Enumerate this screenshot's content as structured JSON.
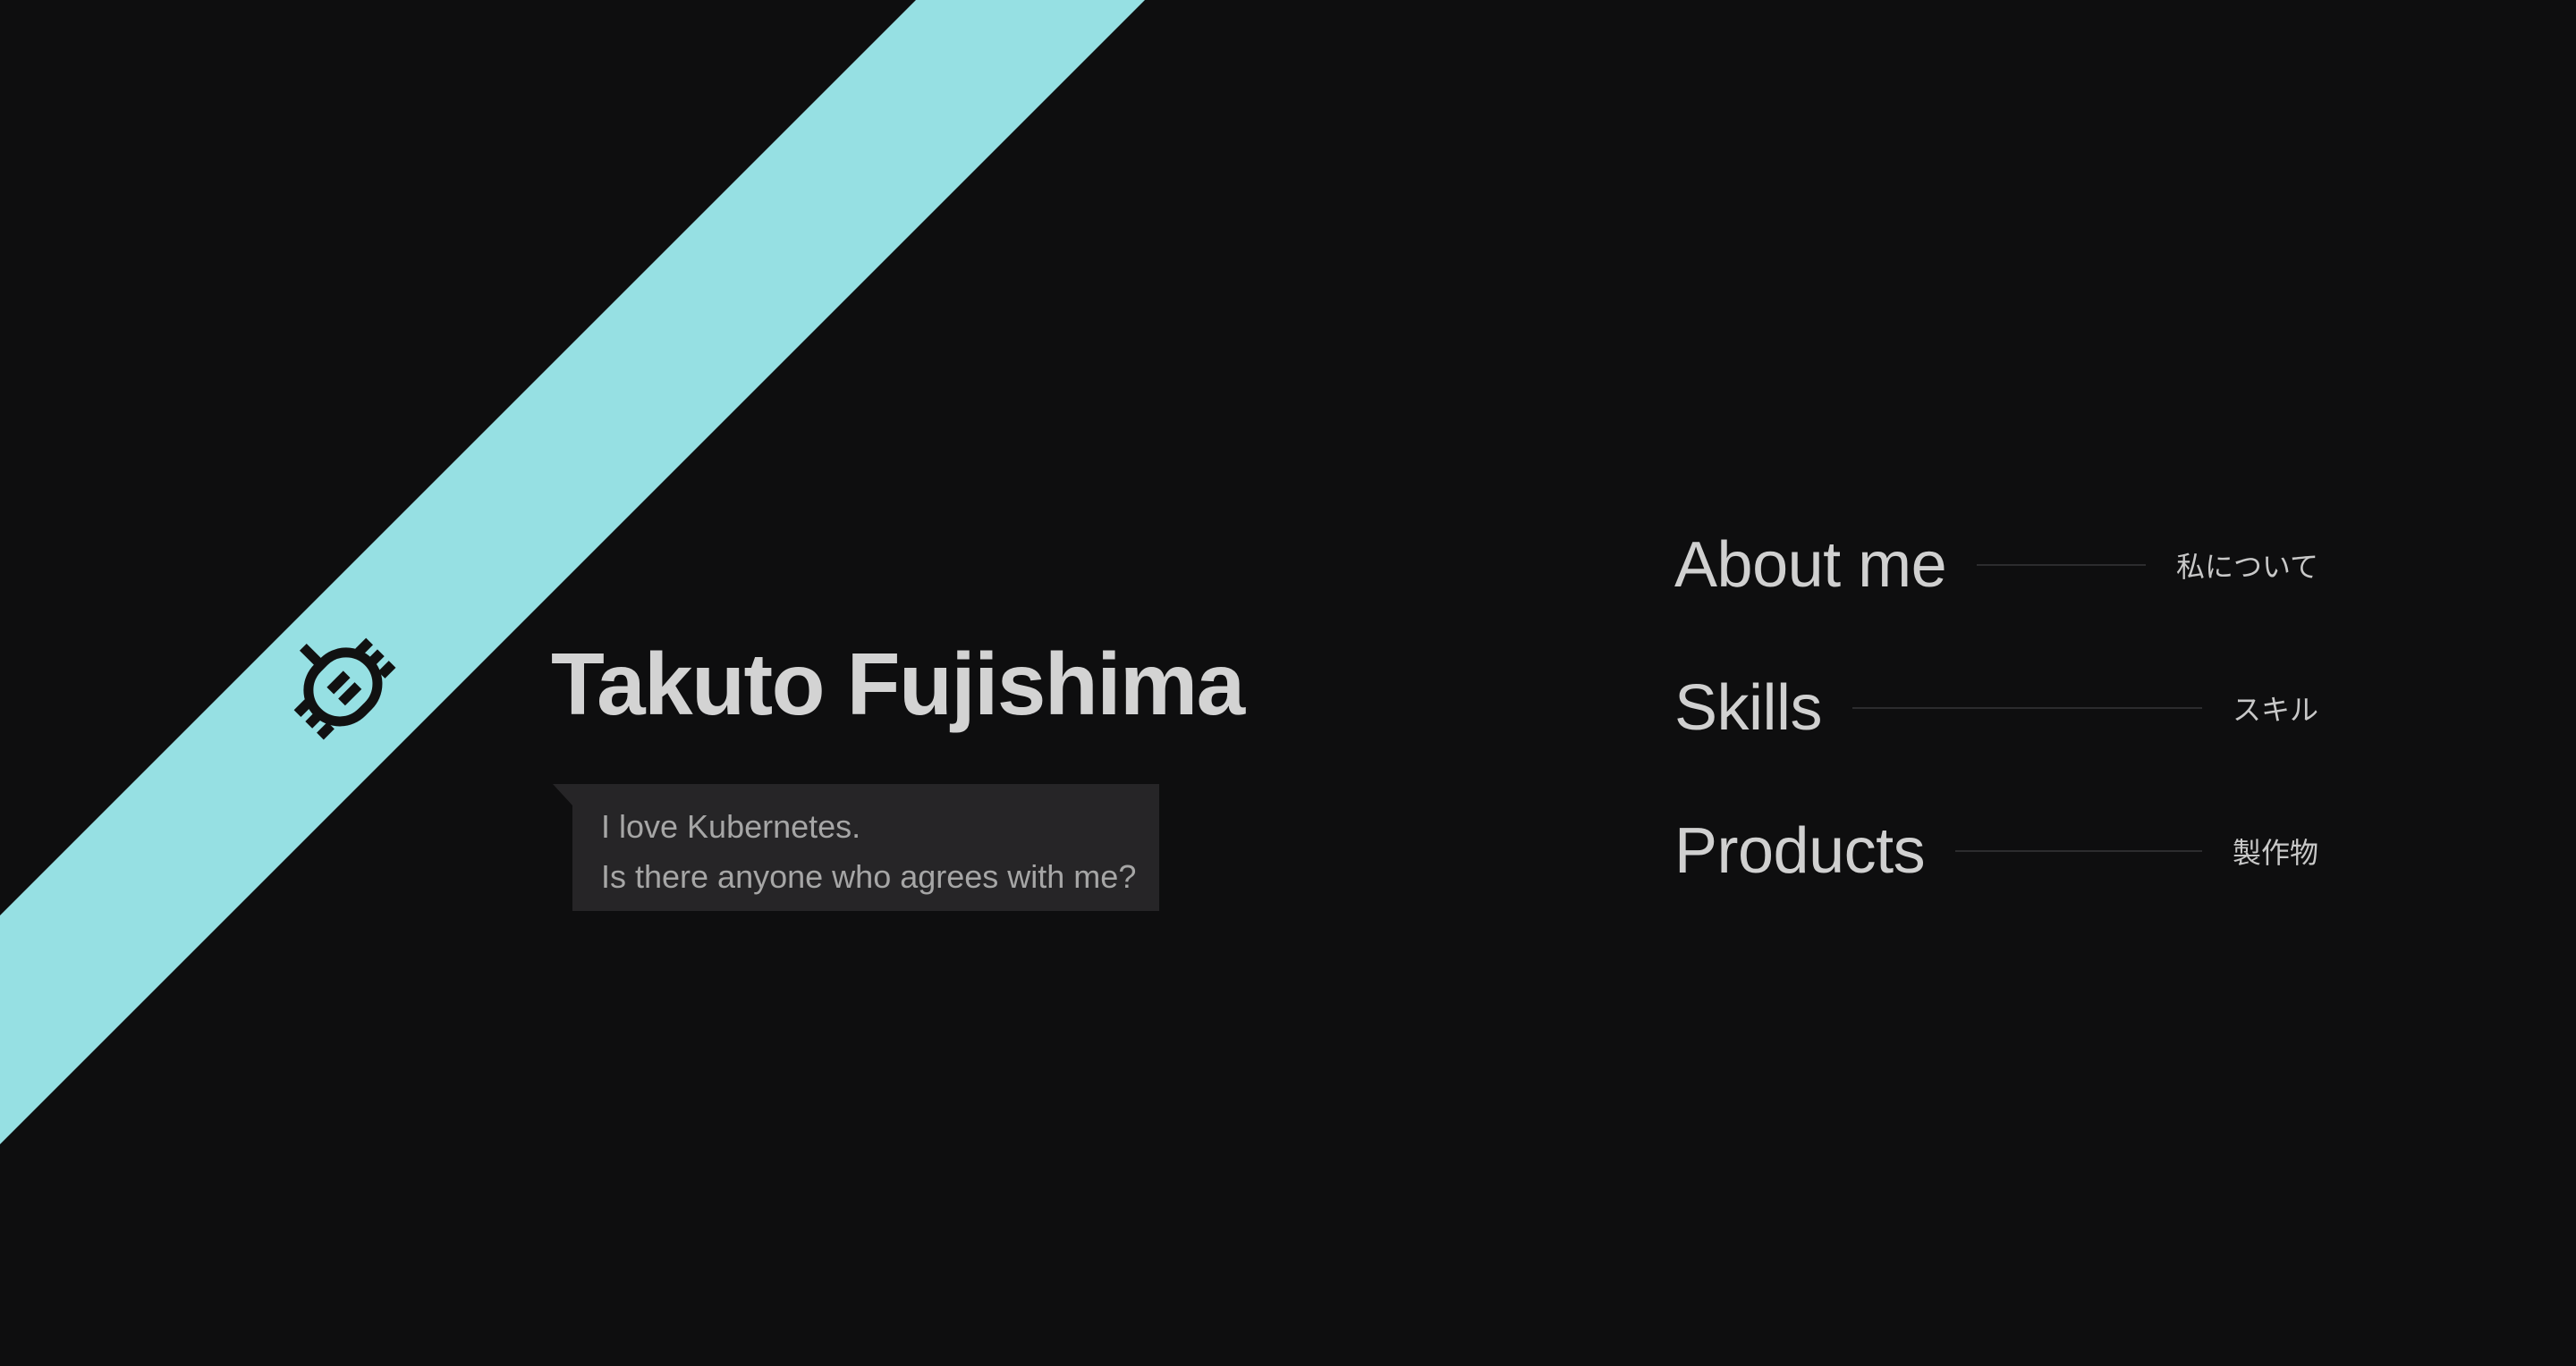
{
  "profile": {
    "name": "Takuto Fujishima",
    "bubble_lines": [
      "I love Kubernetes.",
      "Is there anyone who agrees with me?"
    ],
    "logo_icon": "bug-icon"
  },
  "nav": {
    "items": [
      {
        "label": "About me",
        "sub": "私について"
      },
      {
        "label": "Skills",
        "sub": "スキル"
      },
      {
        "label": "Products",
        "sub": "製作物"
      }
    ]
  },
  "colors": {
    "background": "#0e0e0f",
    "accent": "#96e0e3",
    "text": "#d2d2d2",
    "bubble": "#262527",
    "divider": "#2c2c2e"
  }
}
